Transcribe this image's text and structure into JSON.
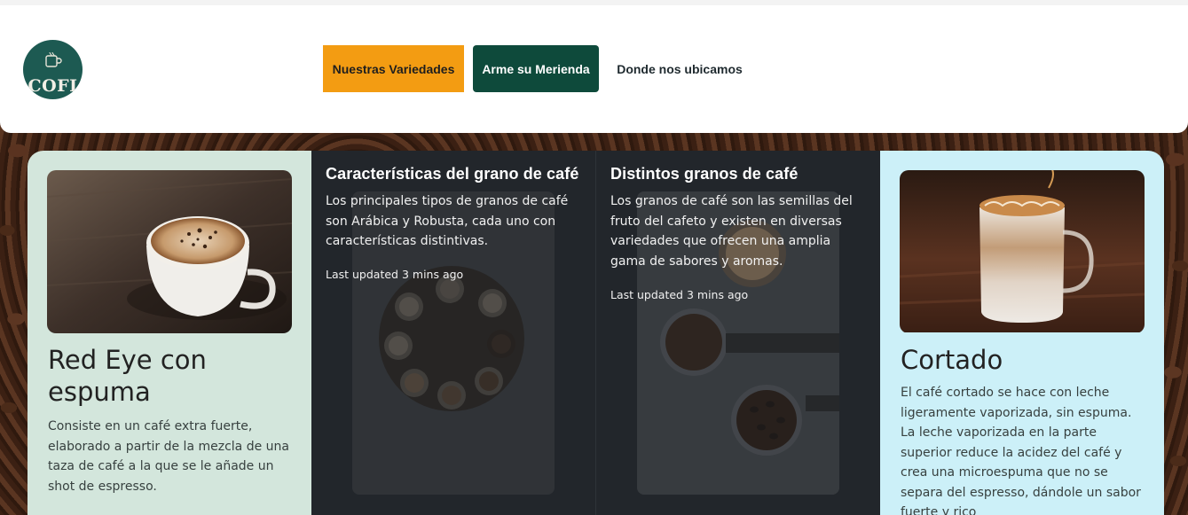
{
  "header": {
    "logo_text": "COFI",
    "nav": [
      {
        "label": "Nuestras Variedades"
      },
      {
        "label": "Arme su Merienda"
      },
      {
        "label": "Donde nos ubicamos"
      }
    ]
  },
  "cards": {
    "left": {
      "title": "Red Eye con espuma",
      "text": "Consiste en un café extra fuerte, elaborado a partir de la mezcla de una taza de café a la que se le añade un shot de espresso."
    },
    "center_left": {
      "title": "Características del grano de café",
      "text": "Los principales tipos de granos de café son Arábica y Robusta, cada uno con características distintivas.",
      "updated": "Last updated 3 mins ago"
    },
    "center_right": {
      "title": "Distintos granos de café",
      "text": "Los granos de café son las semillas del fruto del cafeto y existen en diversas variedades que ofrecen una amplia gama de sabores y aromas.",
      "updated": "Last updated 3 mins ago"
    },
    "right": {
      "title": "Cortado",
      "text": "El café cortado se hace con leche ligeramente vaporizada, sin espuma. La leche vaporizada en la parte superior reduce la acidez del café y crea una microespuma que no se separa del espresso, dándole un sabor fuerte y rico"
    }
  },
  "colors": {
    "accent_orange": "#f39c12",
    "accent_green": "#0e4a3b",
    "card_mint": "#d3e6dc",
    "card_cyan": "#ccf0f8",
    "dark_panel": "#22262b"
  },
  "icons": [
    "coffee-cup-logo-icon"
  ]
}
